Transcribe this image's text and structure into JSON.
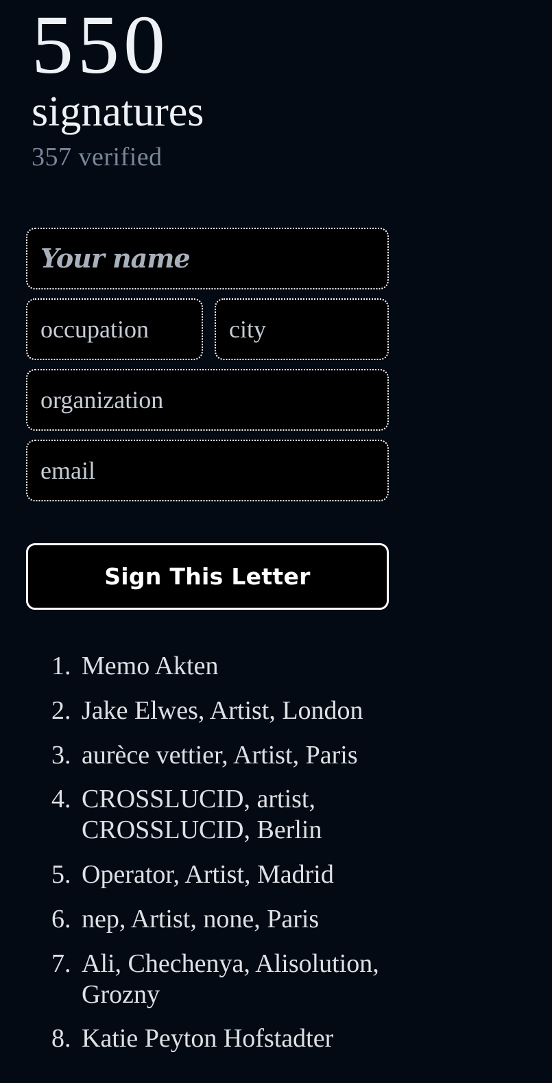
{
  "header": {
    "count": "550",
    "count_label": "signatures",
    "verified_label": "357 verified"
  },
  "form": {
    "name_placeholder": "Your name",
    "occupation_placeholder": "occupation",
    "city_placeholder": "city",
    "organization_placeholder": "organization",
    "email_placeholder": "email",
    "submit_label": "Sign This Letter"
  },
  "signatures": [
    {
      "num": "1.",
      "text": "Memo Akten"
    },
    {
      "num": "2.",
      "text": "Jake Elwes, Artist, London"
    },
    {
      "num": "3.",
      "text": "aurèce vettier, Artist, Paris"
    },
    {
      "num": "4.",
      "text": "CROSSLUCID, artist, CROSSLUCID, Berlin"
    },
    {
      "num": "5.",
      "text": "Operator, Artist, Madrid"
    },
    {
      "num": "6.",
      "text": "nep, Artist, none, Paris"
    },
    {
      "num": "7.",
      "text": "Ali, Chechenya, Alisolution, Grozny"
    },
    {
      "num": "8.",
      "text": "Katie Peyton Hofstadter"
    }
  ],
  "colors": {
    "background": "#040a14",
    "field_fill": "#000000",
    "heading_text": "#eef1f5",
    "verified_text": "#7a8799",
    "placeholder_text": "#c6cdd6",
    "script_placeholder_text": "#a8b0bc",
    "list_text": "#dde0e4",
    "border": "#ffffff"
  }
}
